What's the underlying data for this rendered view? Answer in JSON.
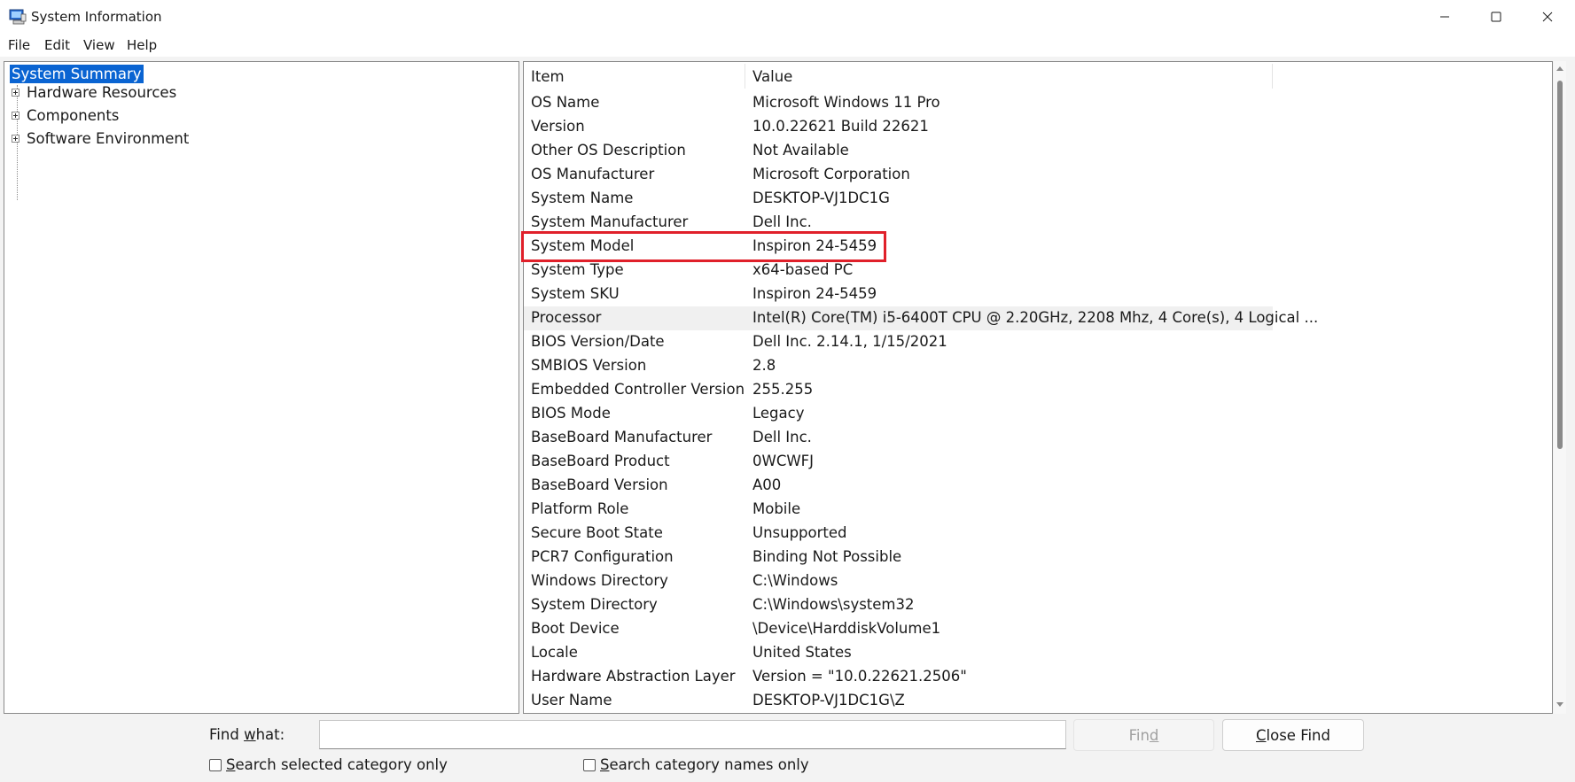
{
  "window": {
    "title": "System Information"
  },
  "menu": [
    "File",
    "Edit",
    "View",
    "Help"
  ],
  "tree": {
    "selected": "System Summary",
    "children": [
      "Hardware Resources",
      "Components",
      "Software Environment"
    ]
  },
  "list": {
    "headers": {
      "item": "Item",
      "value": "Value"
    },
    "rows": [
      {
        "item": "OS Name",
        "value": "Microsoft Windows 11 Pro"
      },
      {
        "item": "Version",
        "value": "10.0.22621 Build 22621"
      },
      {
        "item": "Other OS Description",
        "value": "Not Available"
      },
      {
        "item": "OS Manufacturer",
        "value": "Microsoft Corporation"
      },
      {
        "item": "System Name",
        "value": "DESKTOP-VJ1DC1G"
      },
      {
        "item": "System Manufacturer",
        "value": "Dell Inc."
      },
      {
        "item": "System Model",
        "value": "Inspiron 24-5459"
      },
      {
        "item": "System Type",
        "value": "x64-based PC"
      },
      {
        "item": "System SKU",
        "value": "Inspiron 24-5459"
      },
      {
        "item": "Processor",
        "value": "Intel(R) Core(TM) i5-6400T CPU @ 2.20GHz, 2208 Mhz, 4 Core(s), 4 Logical ..."
      },
      {
        "item": "BIOS Version/Date",
        "value": "Dell Inc. 2.14.1, 1/15/2021"
      },
      {
        "item": "SMBIOS Version",
        "value": "2.8"
      },
      {
        "item": "Embedded Controller Version",
        "value": "255.255"
      },
      {
        "item": "BIOS Mode",
        "value": "Legacy"
      },
      {
        "item": "BaseBoard Manufacturer",
        "value": "Dell Inc."
      },
      {
        "item": "BaseBoard Product",
        "value": "0WCWFJ"
      },
      {
        "item": "BaseBoard Version",
        "value": "A00"
      },
      {
        "item": "Platform Role",
        "value": "Mobile"
      },
      {
        "item": "Secure Boot State",
        "value": "Unsupported"
      },
      {
        "item": "PCR7 Configuration",
        "value": "Binding Not Possible"
      },
      {
        "item": "Windows Directory",
        "value": "C:\\Windows"
      },
      {
        "item": "System Directory",
        "value": "C:\\Windows\\system32"
      },
      {
        "item": "Boot Device",
        "value": "\\Device\\HarddiskVolume1"
      },
      {
        "item": "Locale",
        "value": "United States"
      },
      {
        "item": "Hardware Abstraction Layer",
        "value": "Version = \"10.0.22621.2506\""
      },
      {
        "item": "User Name",
        "value": "DESKTOP-VJ1DC1G\\Z"
      }
    ]
  },
  "find": {
    "label_prefix": "Find ",
    "label_key": "w",
    "label_suffix": "hat:",
    "input_value": "",
    "find_prefix": "Fin",
    "find_key": "d",
    "close_key": "C",
    "close_suffix": "lose Find",
    "chk1_key": "S",
    "chk1_suffix": "earch selected category only",
    "chk2_key": "S",
    "chk2_suffix": "earch category names only"
  },
  "colors": {
    "selection": "#0a64d2",
    "annotation_box": "#e0202a"
  },
  "icons": {
    "app": "system-information-icon",
    "minimize": "minimize-icon",
    "maximize": "maximize-icon",
    "close": "close-icon"
  }
}
